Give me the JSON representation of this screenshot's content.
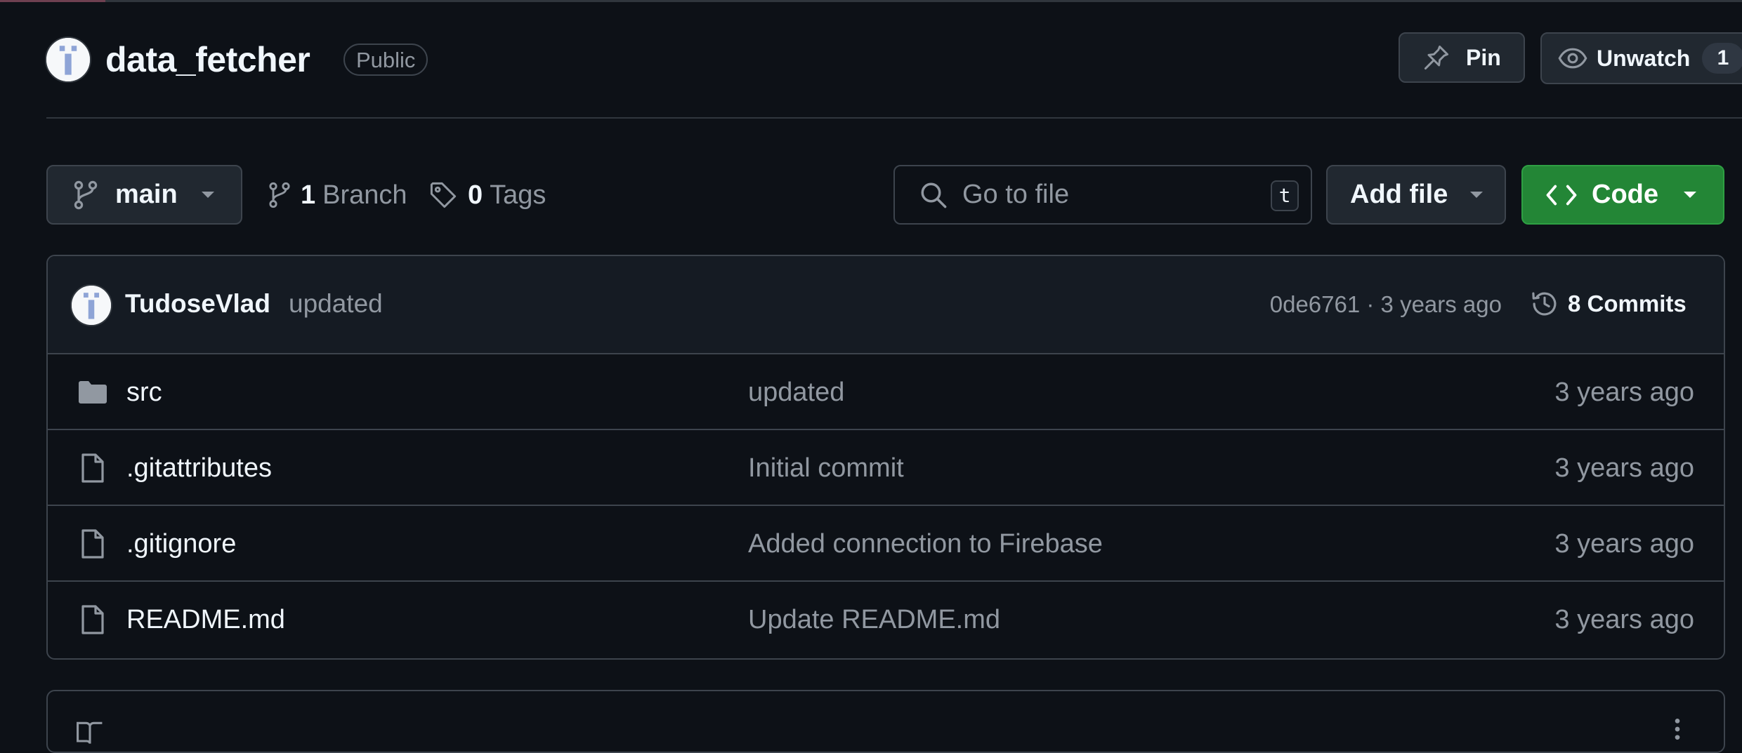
{
  "repo": {
    "name": "data_fetcher",
    "visibility": "Public"
  },
  "actions": {
    "pin_label": "Pin",
    "watch_label": "Unwatch",
    "watch_count": "1"
  },
  "toolbar": {
    "branch": "main",
    "branch_count": "1",
    "branch_label": "Branch",
    "tag_count": "0",
    "tag_label": "Tags",
    "search_placeholder": "Go to file",
    "search_shortcut": "t",
    "add_file_label": "Add file",
    "code_label": "Code"
  },
  "latest_commit": {
    "author": "TudoseVlad",
    "message": "updated",
    "hash_age": "0de6761 · 3 years ago",
    "commits_label": "8 Commits"
  },
  "files": [
    {
      "name": "src",
      "type": "folder",
      "commit": "updated",
      "date": "3 years ago"
    },
    {
      "name": ".gitattributes",
      "type": "file",
      "commit": "Initial commit",
      "date": "3 years ago"
    },
    {
      "name": ".gitignore",
      "type": "file",
      "commit": "Added connection to Firebase",
      "date": "3 years ago"
    },
    {
      "name": "README.md",
      "type": "file",
      "commit": "Update README.md",
      "date": "3 years ago"
    }
  ],
  "colors": {
    "background": "#0d1117",
    "border": "#3d444d",
    "code_button": "#238636",
    "muted_text": "#9198a1"
  },
  "icons": [
    "repo-owner-avatar",
    "pin-icon",
    "eye-icon",
    "git-branch-icon",
    "caret-down-icon",
    "tag-icon",
    "search-icon",
    "code-icon",
    "history-icon",
    "folder-icon",
    "file-icon",
    "book-icon",
    "kebab-icon"
  ]
}
